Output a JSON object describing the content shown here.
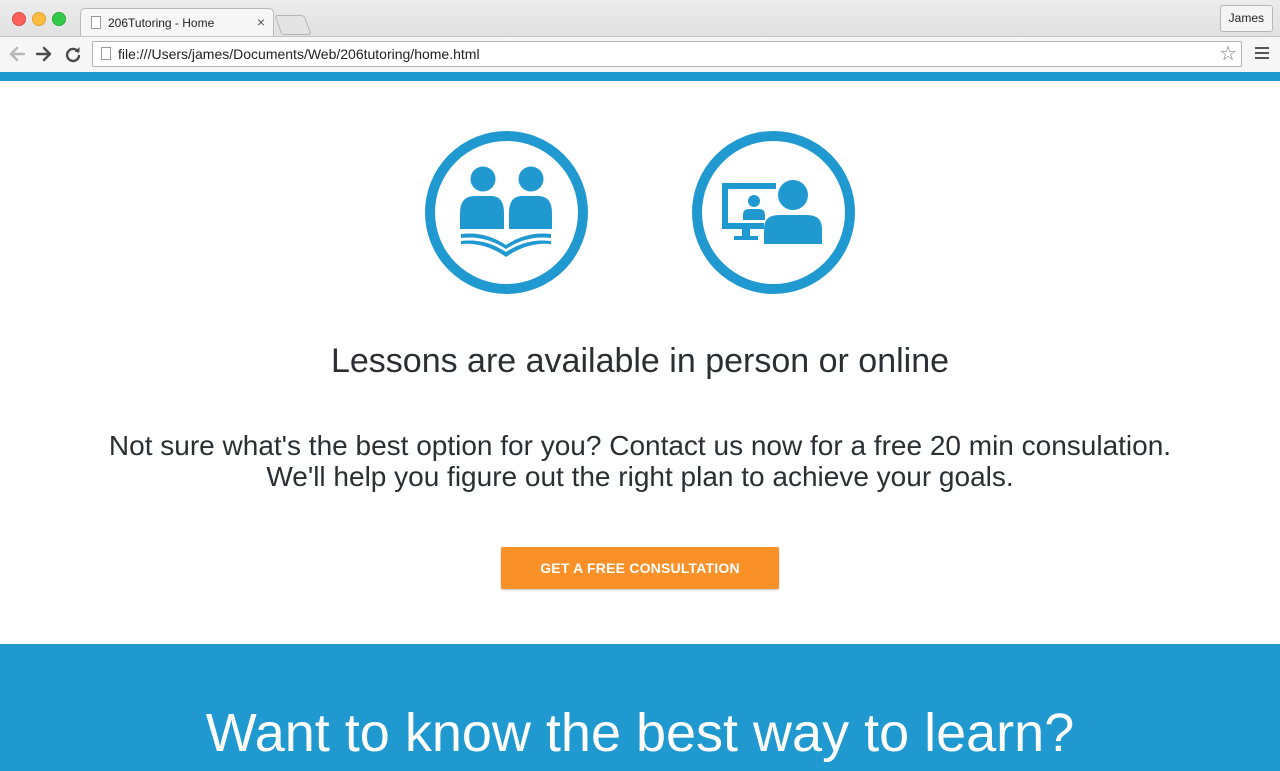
{
  "browser": {
    "tab_title": "206Tutoring - Home",
    "tab_close": "×",
    "profile_name": "James",
    "url": "file:///Users/james/Documents/Web/206tutoring/home.html",
    "star": "☆"
  },
  "icons": {
    "in_person": "reading-students-icon",
    "online": "video-call-icon"
  },
  "main": {
    "heading": "Lessons are available in person or online",
    "consult_line1": "Not sure what's the best option for you? Contact us now for a free 20 min consulation.",
    "consult_line2": "We'll help you figure out the right plan to achieve your goals.",
    "cta_label": "GET A FREE CONSULTATION"
  },
  "section2": {
    "heading": "Want to know the best way to learn?"
  },
  "colors": {
    "brand_blue": "#1f99cf",
    "cta_orange": "#fa9128",
    "text_dark": "#2b2f33"
  }
}
